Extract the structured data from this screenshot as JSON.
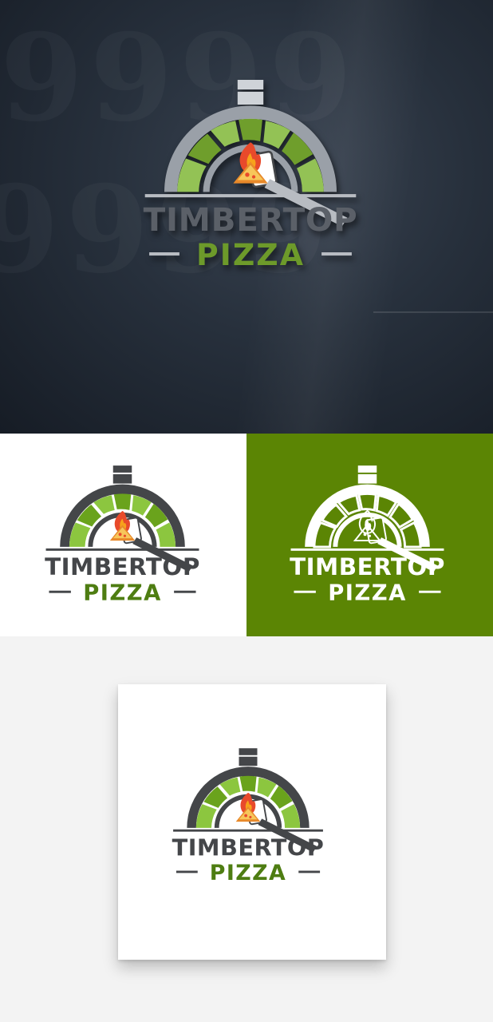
{
  "brand": {
    "name_line1": "TIMBERTOP",
    "name_line2": "PIZZA"
  },
  "variants": [
    {
      "id": "3d-wall-mockup",
      "background": "#222a35"
    },
    {
      "id": "on-white",
      "background": "#ffffff"
    },
    {
      "id": "reversed-on-green",
      "background": "#5b8504"
    },
    {
      "id": "paper-mockup",
      "background": "#f3f3f3"
    }
  ],
  "colors": {
    "charcoal": "#444649",
    "green_light": "#8cc63f",
    "green_mid": "#6aa31c",
    "green_dark": "#4e7d12",
    "flame_red": "#e84a2b",
    "flame_orange": "#f7a21b",
    "white": "#ffffff"
  },
  "icons": {
    "chimney": "chimney-icon",
    "oven_arch": "oven-arch-icon",
    "flame": "flame-icon",
    "pizza_slice": "pizza-slice-icon",
    "pizza_peel": "pizza-peel-icon"
  }
}
